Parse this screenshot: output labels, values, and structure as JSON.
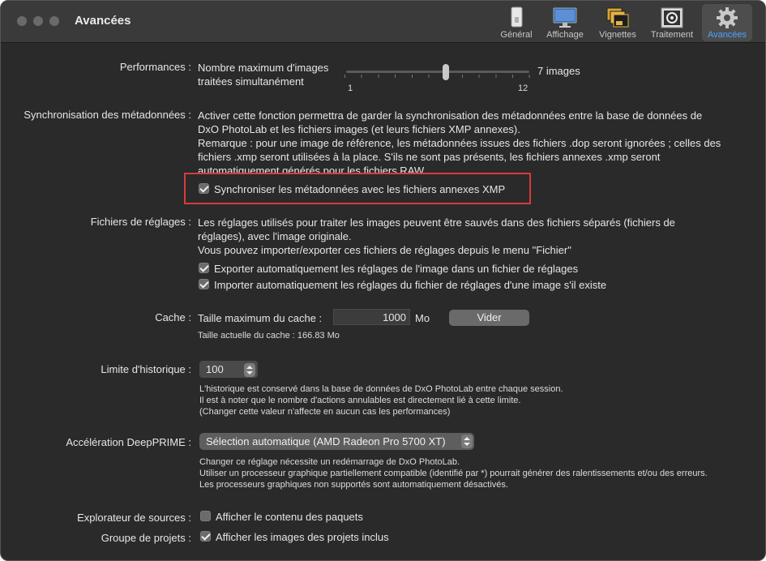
{
  "window": {
    "title": "Avancées"
  },
  "toolbar": {
    "items": [
      {
        "label": "Général",
        "icon": "phone-icon"
      },
      {
        "label": "Affichage",
        "icon": "monitor-icon"
      },
      {
        "label": "Vignettes",
        "icon": "thumbnails-icon"
      },
      {
        "label": "Traitement",
        "icon": "processing-icon"
      },
      {
        "label": "Avancées",
        "icon": "gear-icon",
        "active": true
      }
    ]
  },
  "performances": {
    "label": "Performances :",
    "desc_line1": "Nombre maximum d'images",
    "desc_line2": "traitées simultanément",
    "slider_min": "1",
    "slider_max": "12",
    "slider_value": 7,
    "value_text": "7 images"
  },
  "sync": {
    "label": "Synchronisation des métadonnées :",
    "lines": [
      "Activer cette fonction permettra de garder la synchronisation des métadonnées entre la base de données de",
      "DxO PhotoLab et les fichiers images (et leurs fichiers XMP annexes).",
      "Remarque : pour une image de référence, les métadonnées issues des fichiers .dop seront ignorées ; celles des",
      "fichiers .xmp seront utilisées à la place. S'ils ne sont pas présents, les fichiers annexes .xmp seront",
      "automatiquement générés pour les fichiers RAW."
    ],
    "checkbox_label": "Synchroniser les métadonnées avec les fichiers annexes XMP",
    "checked": true
  },
  "settings_files": {
    "label": "Fichiers de réglages :",
    "lines": [
      "Les réglages utilisés pour traiter les images peuvent être sauvés dans des fichiers séparés (fichiers de",
      "réglages), avec l'image originale.",
      "Vous pouvez importer/exporter ces fichiers de réglages depuis le menu \"Fichier\""
    ],
    "export_label": "Exporter automatiquement les réglages de l'image dans un fichier de réglages",
    "import_label": "Importer automatiquement les réglages du fichier de réglages d'une image s'il existe"
  },
  "cache": {
    "label": "Cache :",
    "max_label": "Taille maximum du cache :",
    "value": "1000",
    "unit": "Mo",
    "button": "Vider",
    "current": "Taille actuelle du cache : 166.83 Mo"
  },
  "history": {
    "label": "Limite d'historique :",
    "value": "100",
    "lines": [
      "L'historique est conservé dans la base de données de DxO PhotoLab entre chaque session.",
      "Il est à noter que le nombre d'actions annulables est directement lié à cette limite.",
      "(Changer cette valeur n'affecte en aucun cas les performances)"
    ]
  },
  "deepprime": {
    "label": "Accélération DeepPRIME :",
    "value": "Sélection automatique (AMD Radeon Pro 5700 XT)",
    "lines": [
      "Changer ce réglage nécessite un redémarrage de DxO PhotoLab.",
      "Utiliser un processeur graphique partiellement compatible (identifié par *) pourrait générer des ralentissements et/ou des erreurs.",
      "Les processeurs graphiques non supportés sont automatiquement désactivés."
    ]
  },
  "sources": {
    "label": "Explorateur de sources :",
    "checkbox_label": "Afficher le contenu des paquets",
    "checked": false
  },
  "projects": {
    "label": "Groupe de projets :",
    "checkbox_label": "Afficher les images des projets inclus",
    "checked": true
  },
  "colors": {
    "highlight": "#d93b3b",
    "accent": "#4aa3ff"
  }
}
